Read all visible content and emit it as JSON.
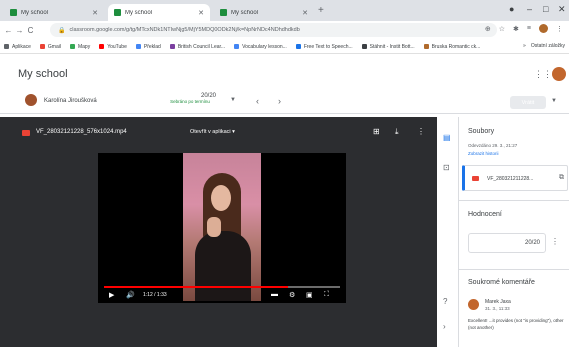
{
  "browser": {
    "tabs": [
      {
        "title": "My school",
        "active": false
      },
      {
        "title": "My school",
        "active": true
      },
      {
        "title": "My school",
        "active": false
      }
    ],
    "url": "classroom.google.com/g/tg/MTcxNDk1NTIwNjg5/MjY5MDQ0ODk2Nj/k=NpNrNDc4NDhdhdkdb",
    "bookmarks": [
      {
        "label": "Aplikace",
        "color": "#5f6368"
      },
      {
        "label": "Gmail",
        "color": "#ea4335"
      },
      {
        "label": "Mapy",
        "color": "#34a853"
      },
      {
        "label": "YouTube",
        "color": "#ff0000"
      },
      {
        "label": "Překlad",
        "color": "#4285f4"
      },
      {
        "label": "British Council Lear...",
        "color": "#7b3fa0"
      },
      {
        "label": "Vocabulary lesson...",
        "color": "#4285f4"
      },
      {
        "label": "Free Text to Speech...",
        "color": "#1a73e8"
      },
      {
        "label": "Stáhnit - Instit Bott...",
        "color": "#3c4043"
      },
      {
        "label": "Bruska Romantic ck...",
        "color": "#b06a2c"
      }
    ],
    "bookmarks_right": [
      "»",
      "Ostatní záložky"
    ]
  },
  "app": {
    "title": "My school"
  },
  "student_bar": {
    "name": "Karolína Jiroušková",
    "grade": "20/20",
    "status": "Sebráno po termínu",
    "return_label": "Vrátit"
  },
  "viewer": {
    "file_name": "VF_28032121228_576x1024.mp4",
    "open_with": "Otevřít v aplikaci",
    "time": "1:12 / 1:33",
    "progress": 0.78
  },
  "panel": {
    "files_title": "Soubory",
    "submitted": "Odevzdáno 29. 3., 21:27",
    "history_link": "Zobrazit historii",
    "attachment_name": "VF_280321211228...",
    "grading_title": "Hodnocení",
    "grade_value": "20/20",
    "comments_title": "Soukromé komentáře",
    "comment": {
      "author": "Marek Jaxa",
      "time": "31. 3., 11:33",
      "text": "Excellent! ...it provides (not \"is providing\"), other (not another)"
    }
  },
  "colors": {
    "accent": "#1a73e8",
    "file_red": "#ea4335",
    "progress_red": "#ff0000",
    "viewer_bg": "#2c2d30"
  }
}
